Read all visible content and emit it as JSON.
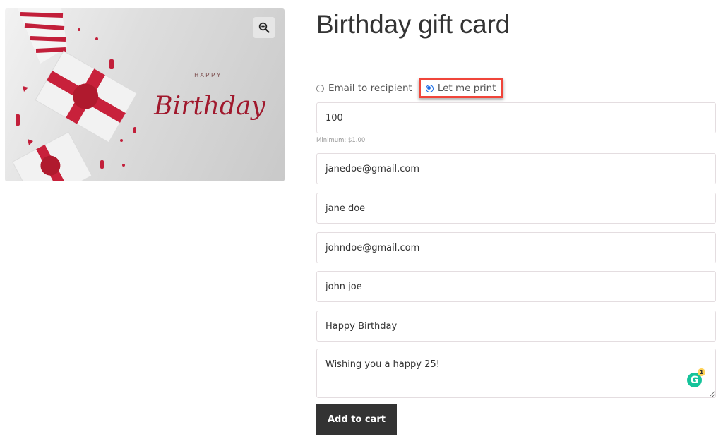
{
  "product": {
    "title": "Birthday gift card",
    "image": {
      "alt": "Happy Birthday gift card design",
      "small_text": "HAPPY",
      "script_text": "Birthday",
      "accent_color": "#b01a2e"
    },
    "zoom_icon": "zoom-in-icon"
  },
  "delivery": {
    "options": [
      {
        "label": "Email to recipient",
        "checked": false
      },
      {
        "label": "Let me print",
        "checked": true
      }
    ],
    "highlight_color": "#f0453a"
  },
  "form": {
    "amount": {
      "value": "100",
      "hint": "Minimum: $1.00"
    },
    "recipient_email": {
      "value": "janedoe@gmail.com"
    },
    "recipient_name": {
      "value": "jane doe"
    },
    "sender_email": {
      "value": "johndoe@gmail.com"
    },
    "sender_name": {
      "value": "john joe"
    },
    "subject": {
      "value": "Happy Birthday"
    },
    "message": {
      "value": "Wishing you a happy 25!"
    },
    "grammarly": {
      "letter": "G",
      "count": "1"
    }
  },
  "actions": {
    "add_to_cart": "Add to cart"
  }
}
